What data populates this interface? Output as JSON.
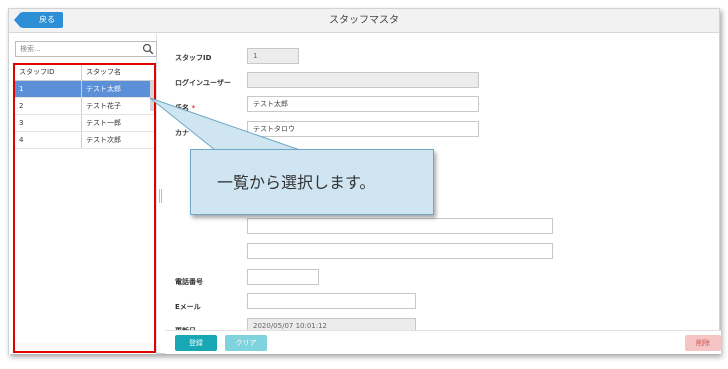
{
  "header": {
    "back_label": "戻る",
    "title": "スタッフマスタ"
  },
  "search": {
    "placeholder": "検索..."
  },
  "staff_list": {
    "columns": [
      "スタッフID",
      "スタッフ名"
    ],
    "rows": [
      {
        "id": "1",
        "name": "テスト太郎",
        "selected": true
      },
      {
        "id": "2",
        "name": "テスト花子",
        "selected": false
      },
      {
        "id": "3",
        "name": "テスト一郎",
        "selected": false
      },
      {
        "id": "4",
        "name": "テスト次郎",
        "selected": false
      }
    ]
  },
  "form": {
    "staff_id": {
      "label": "スタッフID",
      "value": "1"
    },
    "login_user": {
      "label": "ログインユーザー",
      "value": ""
    },
    "name": {
      "label": "氏名",
      "required_mark": "*",
      "value": "テスト太郎"
    },
    "kana": {
      "label": "カナ",
      "value": "テストタロウ"
    },
    "phone": {
      "label": "電話番号",
      "value": ""
    },
    "email": {
      "label": "Eメール",
      "value": ""
    },
    "updated": {
      "label": "更新日",
      "value": "2020/05/07 10:01:12"
    }
  },
  "footer": {
    "save_label": "登録",
    "clear_label": "クリア",
    "delete_label": "削除"
  },
  "callout": {
    "text": "一覧から選択します。"
  },
  "colors": {
    "accent": "#2e8fd6",
    "selected_row": "#5b8fd8",
    "highlight_border": "#e00000",
    "save": "#17a7b5"
  }
}
